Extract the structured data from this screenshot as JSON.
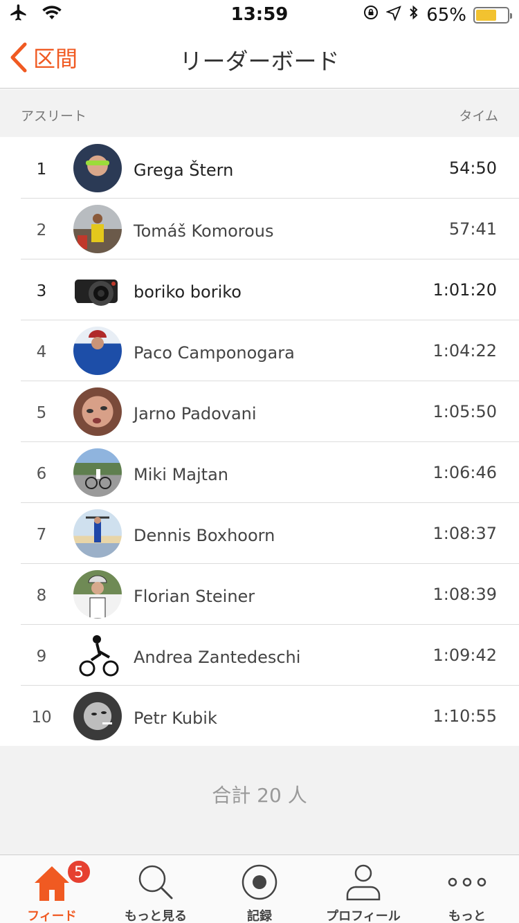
{
  "status_bar": {
    "time": "13:59",
    "battery": "65%",
    "battery_level": 0.65,
    "battery_color": "#f2c230"
  },
  "nav": {
    "back_label": "区間",
    "title": "リーダーボード"
  },
  "section": {
    "athlete_header": "アスリート",
    "time_header": "タイム"
  },
  "leaderboard": [
    {
      "rank": "1",
      "name": "Grega Štern",
      "time": "54:50"
    },
    {
      "rank": "2",
      "name": "Tomáš Komorous",
      "time": "57:41"
    },
    {
      "rank": "3",
      "name": "boriko boriko",
      "time": "1:01:20"
    },
    {
      "rank": "4",
      "name": "Paco Camponogara",
      "time": "1:04:22"
    },
    {
      "rank": "5",
      "name": "Jarno Padovani",
      "time": "1:05:50"
    },
    {
      "rank": "6",
      "name": "Miki Majtan",
      "time": "1:06:46"
    },
    {
      "rank": "7",
      "name": "Dennis Boxhoorn",
      "time": "1:08:37"
    },
    {
      "rank": "8",
      "name": "Florian Steiner",
      "time": "1:08:39"
    },
    {
      "rank": "9",
      "name": "Andrea Zantedeschi",
      "time": "1:09:42"
    },
    {
      "rank": "10",
      "name": "Petr Kubik",
      "time": "1:10:55"
    }
  ],
  "total": "合計 20 人",
  "tabs": [
    {
      "label": "フィード",
      "icon": "home-icon",
      "active": true,
      "badge": "5"
    },
    {
      "label": "もっと見る",
      "icon": "search-icon"
    },
    {
      "label": "記録",
      "icon": "record-icon"
    },
    {
      "label": "プロフィール",
      "icon": "profile-icon"
    },
    {
      "label": "もっと",
      "icon": "more-icon"
    }
  ],
  "colors": {
    "accent": "#f05a22",
    "badge": "#e64030"
  }
}
